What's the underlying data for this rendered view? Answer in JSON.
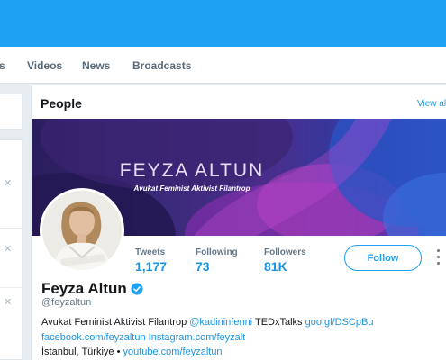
{
  "tabs": [
    "s",
    "Videos",
    "News",
    "Broadcasts"
  ],
  "people": {
    "title": "People",
    "view_all": "View all"
  },
  "profile": {
    "banner_title": "FEYZA ALTUN",
    "banner_subtitle": "Avukat Feminist Aktivist Filantrop",
    "name": "Feyza Altun",
    "handle": "@feyzaltun",
    "verified": true,
    "stats": {
      "tweets_label": "Tweets",
      "tweets_value": "1,177",
      "following_label": "Following",
      "following_value": "73",
      "followers_label": "Followers",
      "followers_value": "81K"
    },
    "follow_label": "Follow",
    "bio": {
      "text1": "Avukat Feminist Aktivist Filantrop ",
      "mention": "@kadininfenni",
      "text2": " TEDxTalks ",
      "link1": "goo.gl/DSCpBu",
      "link2": "facebook.com/feyzaltun",
      "link3": "Instagram.com/feyzalt"
    },
    "location": "İstanbul, Türkiye",
    "separator": " • ",
    "website": "youtube.com/feyzaltun"
  },
  "colors": {
    "brand": "#1da1f2",
    "link": "#1b95e0",
    "background": "#e6ecf0"
  }
}
